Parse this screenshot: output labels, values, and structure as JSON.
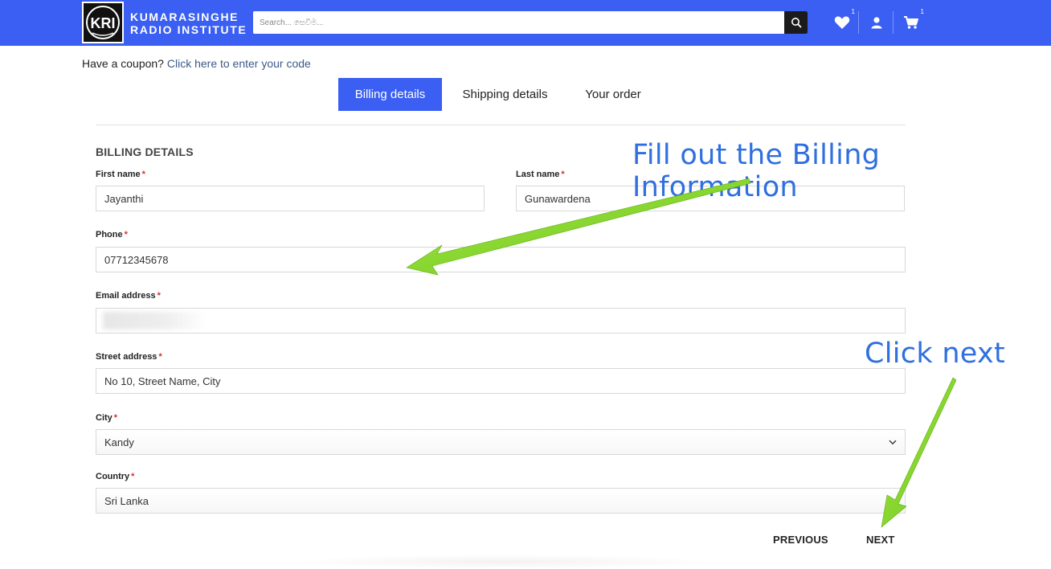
{
  "header": {
    "brand_line1": "KUMARASINGHE",
    "brand_line2": "RADIO INSTITUTE",
    "logo_text": "KRI",
    "search_placeholder": "Search... සෙවීම...",
    "wishlist_count": "1",
    "cart_count": "1",
    "bg_color": "#3a5ff2"
  },
  "coupon": {
    "prompt": "Have a coupon?",
    "link": "Click here to enter your code"
  },
  "tabs": [
    {
      "label": "Billing details",
      "active": true
    },
    {
      "label": "Shipping details",
      "active": false
    },
    {
      "label": "Your order",
      "active": false
    }
  ],
  "form": {
    "section_title": "BILLING DETAILS",
    "required_mark": "*",
    "first_name": {
      "label": "First name",
      "value": "Jayanthi"
    },
    "last_name": {
      "label": "Last name",
      "value": "Gunawardena"
    },
    "phone": {
      "label": "Phone",
      "value": "07712345678"
    },
    "email": {
      "label": "Email address",
      "value": ""
    },
    "street": {
      "label": "Street address",
      "value": "No 10, Street Name, City"
    },
    "city": {
      "label": "City",
      "value": "Kandy"
    },
    "country": {
      "label": "Country",
      "value": "Sri Lanka"
    }
  },
  "nav": {
    "previous": "PREVIOUS",
    "next": "NEXT"
  },
  "annotations": {
    "fill_out": "Fill out the Billing Information",
    "click_next": "Click next",
    "text_color": "#2f6fe0",
    "arrow_color": "#7ed321"
  },
  "icons": [
    "search-icon",
    "heart-icon",
    "user-icon",
    "cart-icon",
    "chevron-down-icon"
  ]
}
